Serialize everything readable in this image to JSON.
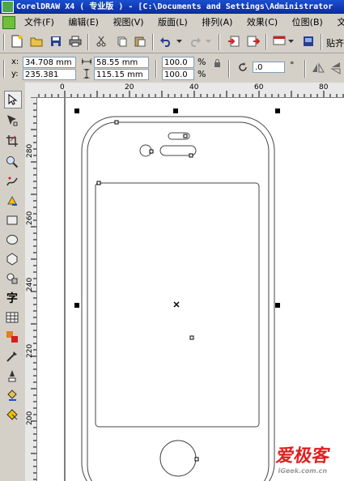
{
  "window": {
    "title": "CorelDRAW X4 ( 专业版 ) - [C:\\Documents and Settings\\Administrator"
  },
  "menu": [
    "文件(F)",
    "编辑(E)",
    "视图(V)",
    "版面(L)",
    "排列(A)",
    "效果(C)",
    "位图(B)",
    "文本"
  ],
  "toolbar": {
    "paste_label": "贴齐"
  },
  "props": {
    "x": "34.708 mm",
    "y": "235.381 mm",
    "w": "58.55 mm",
    "h": "115.15 mm",
    "scale_w": "100.0",
    "scale_h": "100.0",
    "pct": "%",
    "angle": ".0",
    "deg": "°",
    "x_label": "x:",
    "y_label": "y:"
  },
  "ruler": {
    "h_ticks": [
      "0",
      "20",
      "40",
      "60",
      "80"
    ],
    "v_ticks": [
      "280",
      "260",
      "240",
      "220",
      "200"
    ]
  },
  "tools": [
    "pick-tool",
    "shape-tool",
    "crop-tool",
    "zoom-tool",
    "freehand-tool",
    "smart-fill-tool",
    "rectangle-tool",
    "ellipse-tool",
    "polygon-tool",
    "basic-shapes-tool",
    "text-tool",
    "table-tool",
    "interactive-tool",
    "eyedropper-tool",
    "outline-tool",
    "fill-tool",
    "interactive-fill-tool"
  ],
  "text_tool_label": "字",
  "watermark": {
    "main": "爱极客",
    "sub": "iGeek.com.cn"
  }
}
